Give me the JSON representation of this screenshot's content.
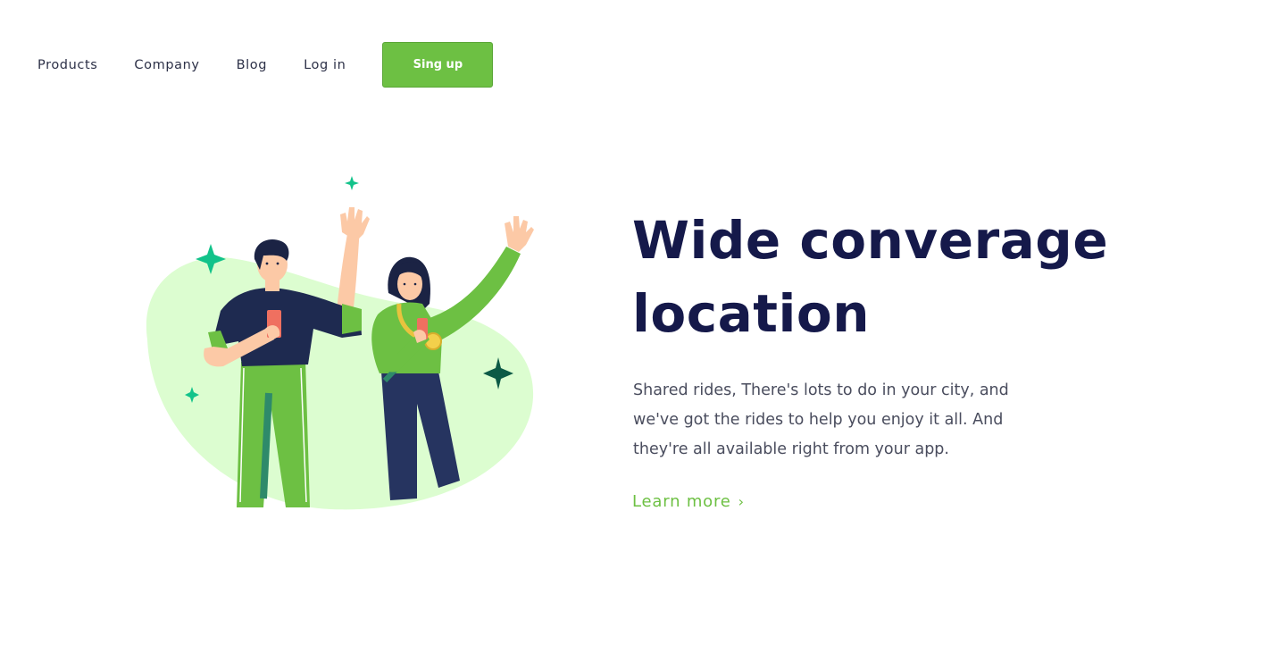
{
  "nav": {
    "links": [
      "Products",
      "Company",
      "Blog",
      "Log in"
    ],
    "signup_label": "Sing up"
  },
  "hero": {
    "title_line1": "Wide converage",
    "title_line2": "location",
    "description": "Shared rides, There's lots to do in your city, and we've got the rides to help you enjoy it all. And they're all available right from your app.",
    "learn_more_label": "Learn more",
    "learn_more_icon": "chevron-right-icon"
  },
  "colors": {
    "accent": "#6dc043",
    "title": "#15194a",
    "blob": "#dcfdd0",
    "navy": "#263460",
    "sparkle_teal": "#12c38a",
    "sparkle_dark": "#0c5a46"
  }
}
